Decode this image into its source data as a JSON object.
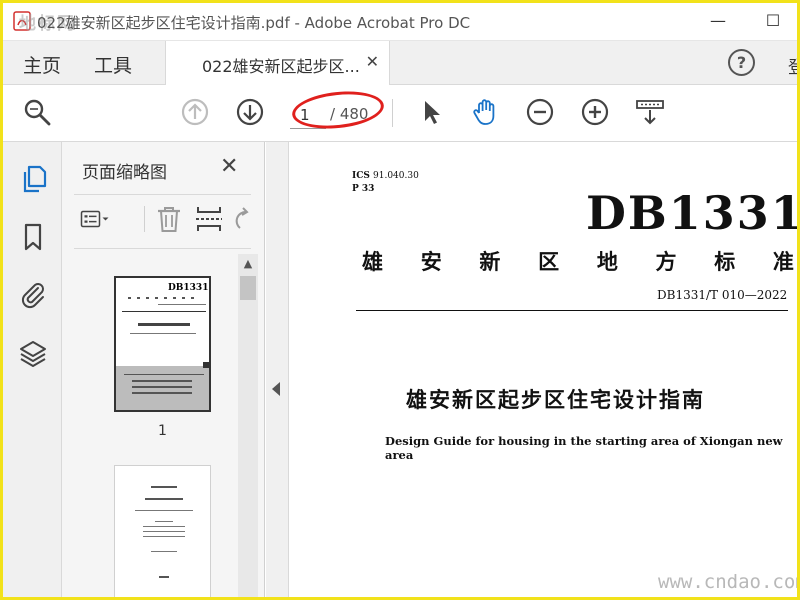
{
  "window": {
    "title": "022雄安新区起步区住宅设计指南.pdf - Adobe Acrobat Pro DC",
    "watermark_logo": "地标网",
    "minimize_glyph": "—",
    "maximize_glyph": "☐"
  },
  "menu": {
    "home": "主页",
    "tools": "工具",
    "doc_tab_label": "022雄安新区起步区...",
    "doc_tab_close": "✕",
    "help_glyph": "?",
    "signin_partial": "登"
  },
  "toolbar": {
    "page_current": "1",
    "page_total": "/ 480"
  },
  "thumbnail_panel": {
    "title": "页面缩略图",
    "close_glyph": "✕",
    "scroll_up_glyph": "▲",
    "thumbs": [
      {
        "number": "1",
        "code": "DB1331"
      }
    ]
  },
  "document": {
    "ics_label": "ICS",
    "ics_value": "91.040.30",
    "p_code": "P 33",
    "db_code": "DB1331",
    "standard_type_chars": [
      "雄",
      "安",
      "新",
      "区",
      "地",
      "方",
      "标",
      "准"
    ],
    "standard_number": "DB1331/T 010—2022",
    "title_cn": "雄安新区起步区住宅设计指南",
    "title_en": "Design Guide for housing in the starting area of Xiongan new area"
  },
  "overlay": {
    "site_watermark": "www.cndao.com",
    "highlight_color": "#e0201d",
    "frame_color": "#f2e21a",
    "accent_blue": "#1a73c8"
  }
}
